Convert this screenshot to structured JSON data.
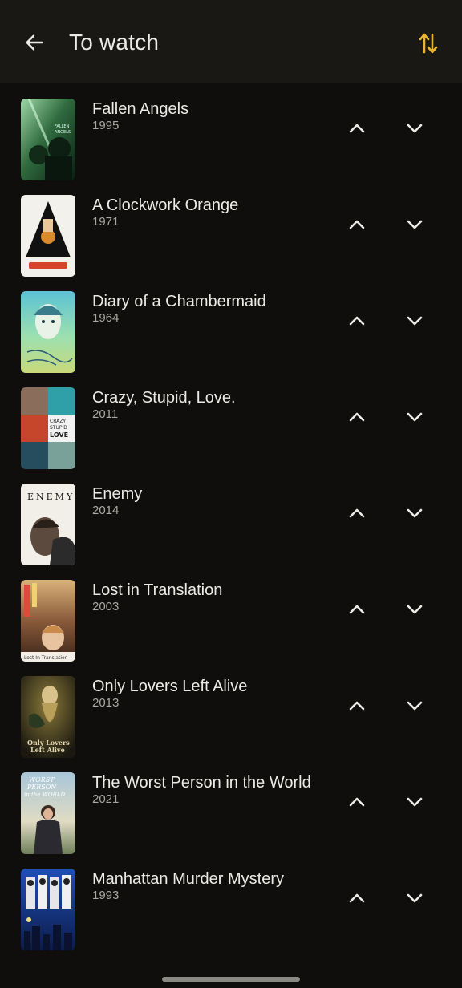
{
  "app_bar": {
    "title": "To watch",
    "back_icon": "arrow-left-icon",
    "sort_icon": "sort-arrows-icon",
    "accent_color": "#e7b52f"
  },
  "movies": [
    {
      "title": "Fallen Angels",
      "year": "1995",
      "poster_text": "FALLEN ANGELS"
    },
    {
      "title": "A Clockwork Orange",
      "year": "1971",
      "poster_text": ""
    },
    {
      "title": "Diary of a Chambermaid",
      "year": "1964",
      "poster_text": ""
    },
    {
      "title": "Crazy, Stupid, Love.",
      "year": "2011",
      "poster_text": "CRAZY STUPID LOVE"
    },
    {
      "title": "Enemy",
      "year": "2014",
      "poster_text": "ENEMY"
    },
    {
      "title": "Lost in Translation",
      "year": "2003",
      "poster_text": "Lost In Translation"
    },
    {
      "title": "Only Lovers Left Alive",
      "year": "2013",
      "poster_text": "Only Lovers Left Alive"
    },
    {
      "title": "The Worst Person in the World",
      "year": "2021",
      "poster_text": "WORST PERSON in the WORLD"
    },
    {
      "title": "Manhattan Murder Mystery",
      "year": "1993",
      "poster_text": ""
    }
  ],
  "row_controls": {
    "up_icon": "chevron-up-icon",
    "down_icon": "chevron-down-icon"
  }
}
